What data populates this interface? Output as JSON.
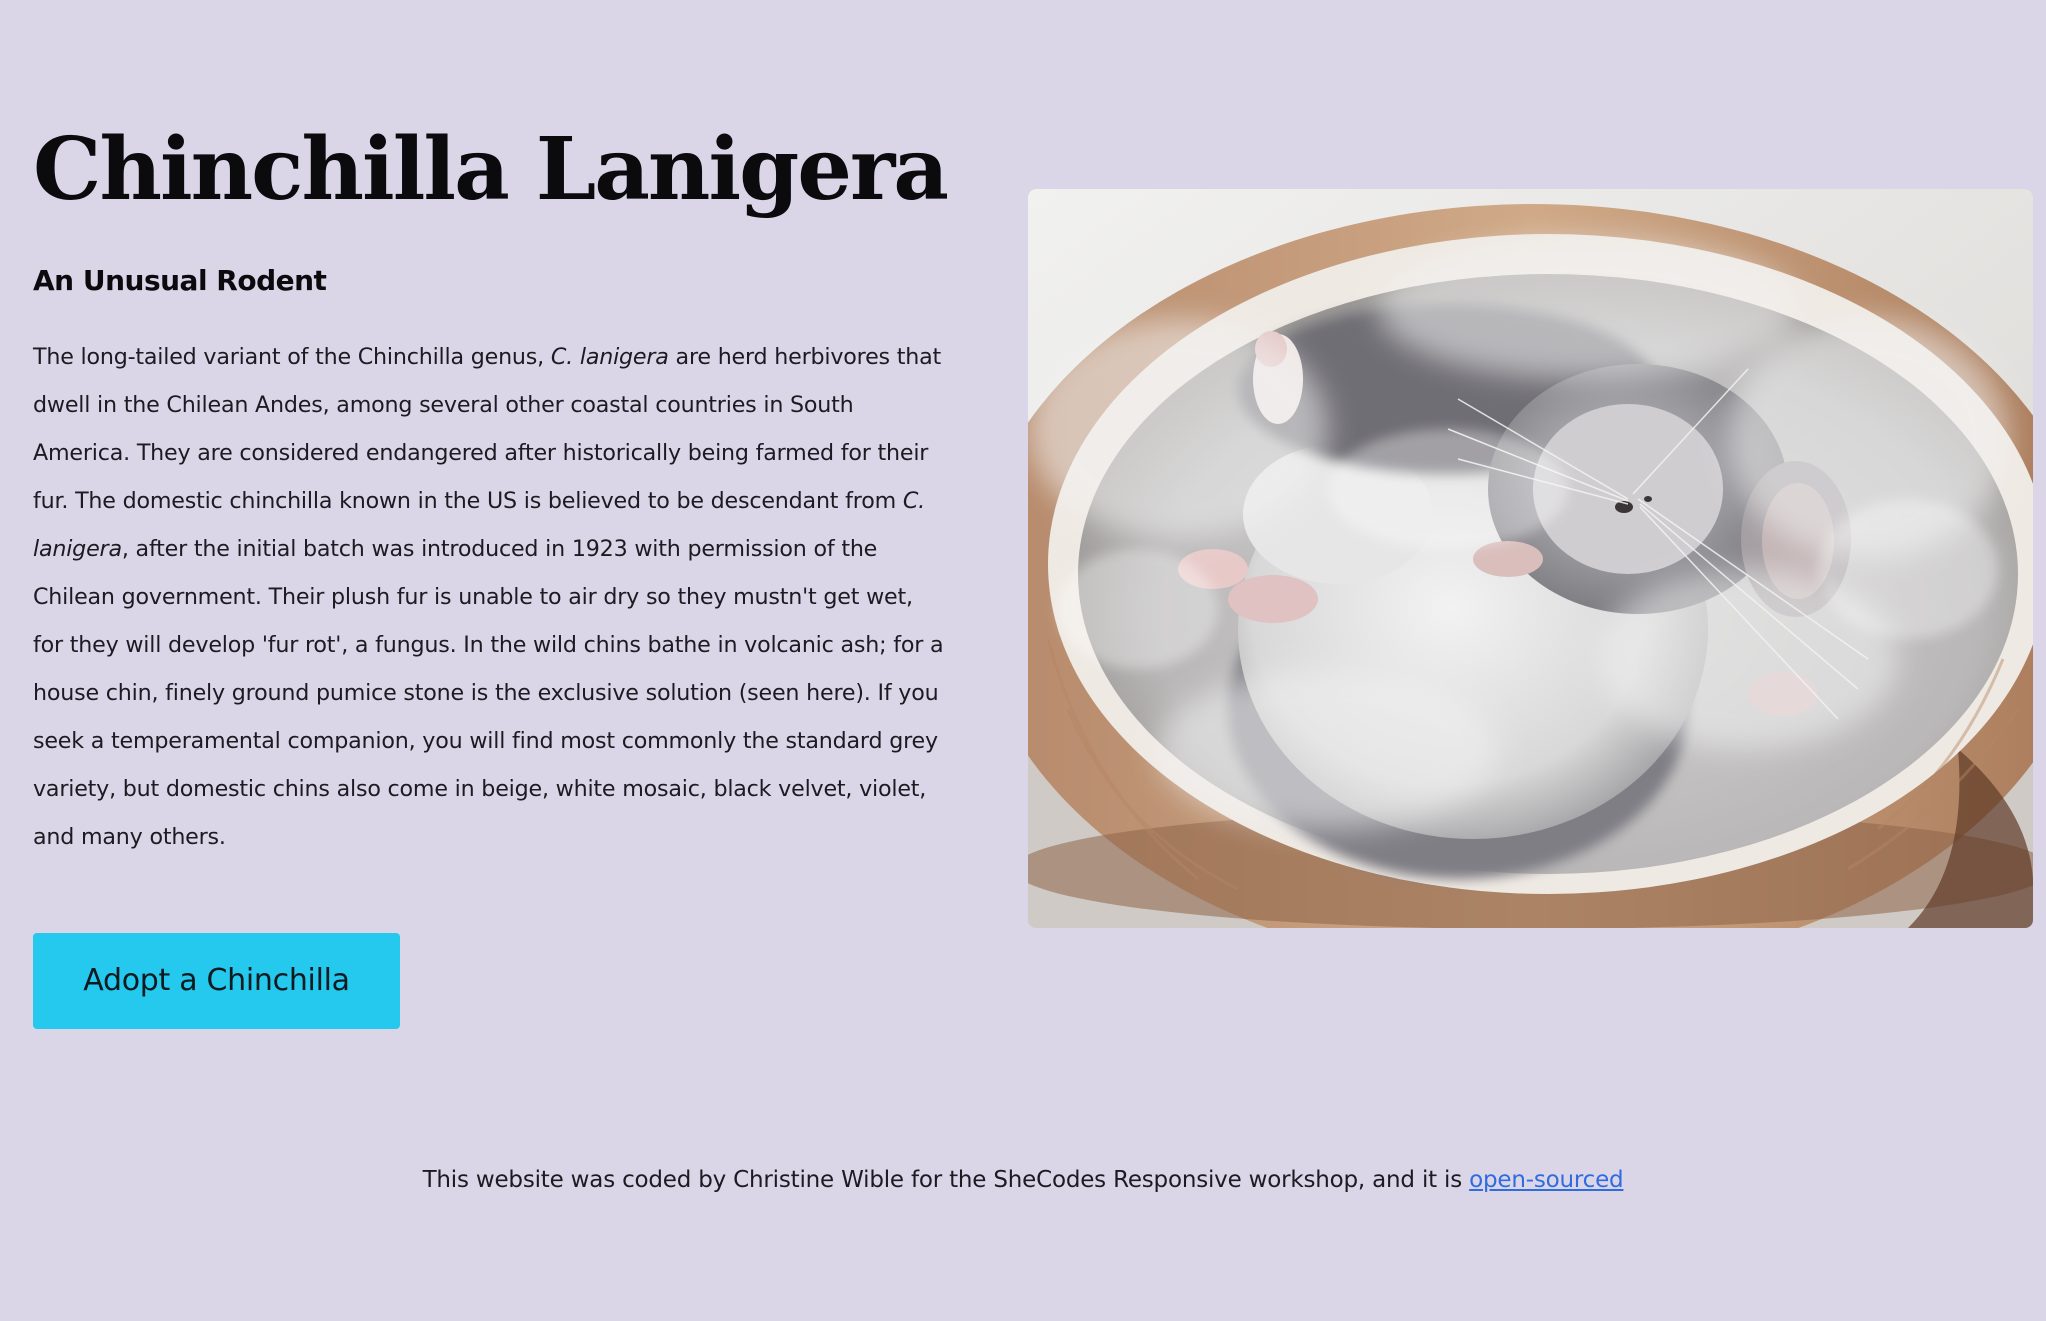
{
  "page": {
    "title": "Chinchilla Lanigera",
    "subtitle": "An Unusual Rodent"
  },
  "intro": {
    "part1": "The long-tailed variant of the Chinchilla genus, ",
    "species_1": "C. lanigera",
    "part2": " are herd herbivores that dwell in the Chilean Andes, among several other coastal countries in South America. They are considered endangered after historically being farmed for their fur. The domestic chinchilla known in the US is believed to be descendant from ",
    "species_2": "C. lanigera",
    "part3": ", after the initial batch was introduced in 1923 with permission of the Chilean government. Their plush fur is unable to air dry so they mustn't get wet, for they will develop 'fur rot', a fungus. In the wild chins bathe in volcanic ash; for a house chin, finely ground pumice stone is the exclusive solution (seen here). If you seek a temperamental companion, you will find most commonly the standard grey variety, but domestic chins also come in beige, white mosaic, black velvet, violet, and many others."
  },
  "cta": {
    "label": "Adopt a Chinchilla"
  },
  "image": {
    "alt": "A chinchilla rolling on its back in a wooden tub full of dust"
  },
  "footer": {
    "text": "This website was coded by Christine Wible for the SheCodes Responsive workshop, and it is ",
    "link_label": "open-sourced"
  },
  "colors": {
    "background": "#dbd5e8",
    "button": "#24c9ed",
    "link": "#2f6ce0",
    "heading": "#0b0a0d",
    "body_text": "#1d1b22"
  }
}
